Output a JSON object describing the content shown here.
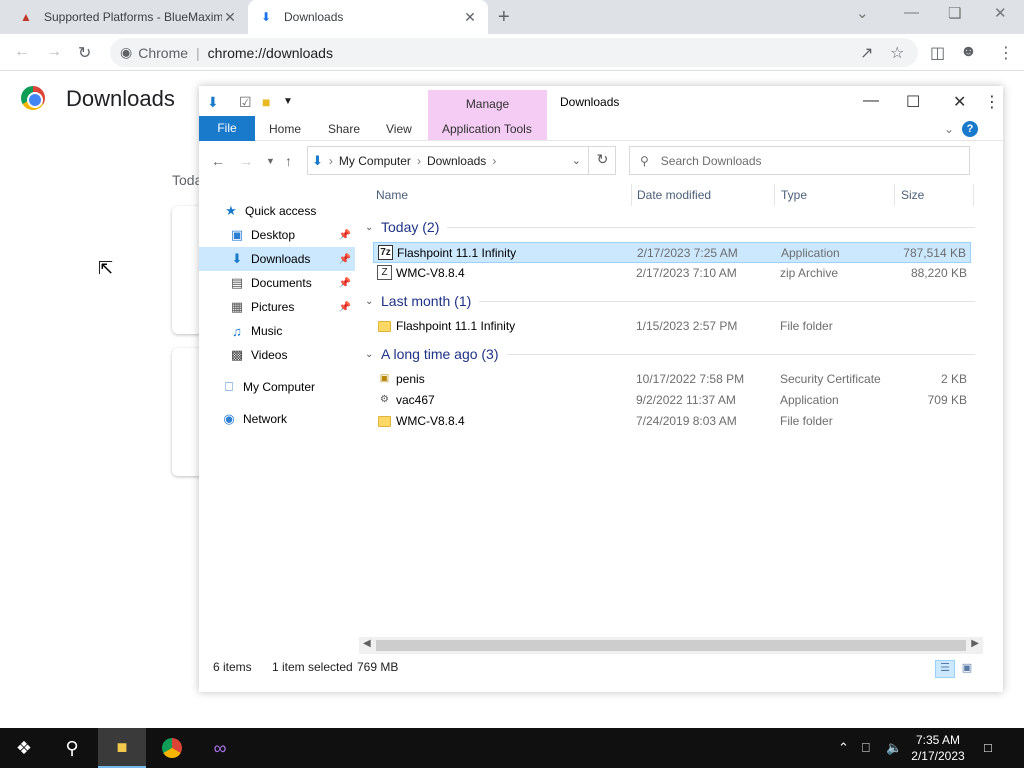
{
  "chrome": {
    "tabs": [
      {
        "title": "Supported Platforms - BlueMaxim",
        "icon": "flashpoint-favicon"
      },
      {
        "title": "Downloads",
        "icon": "download-icon"
      }
    ],
    "omnibox": {
      "site_label": "Chrome",
      "url": "chrome://downloads"
    },
    "page_title": "Downloads",
    "today_label": "Toda"
  },
  "explorer": {
    "title": "Downloads",
    "context_tab": "Manage",
    "ribbon_tabs": [
      "File",
      "Home",
      "Share",
      "View",
      "Application Tools"
    ],
    "address": [
      "My Computer",
      "Downloads"
    ],
    "search_placeholder": "Search Downloads",
    "nav": [
      {
        "label": "Quick access",
        "icon": "star-icon"
      },
      {
        "label": "Desktop",
        "icon": "desktop-icon",
        "pinned": true
      },
      {
        "label": "Downloads",
        "icon": "download-icon",
        "pinned": true,
        "selected": true
      },
      {
        "label": "Documents",
        "icon": "document-icon",
        "pinned": true
      },
      {
        "label": "Pictures",
        "icon": "picture-icon",
        "pinned": true
      },
      {
        "label": "Music",
        "icon": "music-icon"
      },
      {
        "label": "Videos",
        "icon": "video-icon"
      },
      {
        "label": "My Computer",
        "icon": "computer-icon"
      },
      {
        "label": "Network",
        "icon": "network-icon"
      }
    ],
    "columns": [
      "Name",
      "Date modified",
      "Type",
      "Size"
    ],
    "groups": [
      {
        "label": "Today (2)",
        "files": [
          {
            "name": "Flashpoint 11.1 Infinity",
            "date": "2/17/2023 7:25 AM",
            "type": "Application",
            "size": "787,514 KB",
            "icon": "7z-icon",
            "selected": true
          },
          {
            "name": "WMC-V8.8.4",
            "date": "2/17/2023 7:10 AM",
            "type": "zip Archive",
            "size": "88,220 KB",
            "icon": "zip-icon"
          }
        ]
      },
      {
        "label": "Last month (1)",
        "files": [
          {
            "name": "Flashpoint 11.1 Infinity",
            "date": "1/15/2023 2:57 PM",
            "type": "File folder",
            "size": "",
            "icon": "folder-icon"
          }
        ]
      },
      {
        "label": "A long time ago (3)",
        "files": [
          {
            "name": "penis",
            "date": "10/17/2022 7:58 PM",
            "type": "Security Certificate",
            "size": "2 KB",
            "icon": "certificate-icon"
          },
          {
            "name": "vac467",
            "date": "9/2/2022 11:37 AM",
            "type": "Application",
            "size": "709 KB",
            "icon": "app-icon"
          },
          {
            "name": "WMC-V8.8.4",
            "date": "7/24/2019 8:03 AM",
            "type": "File folder",
            "size": "",
            "icon": "folder-icon"
          }
        ]
      }
    ],
    "status": {
      "items": "6 items",
      "selected": "1 item selected",
      "size": "769 MB"
    }
  },
  "taskbar": {
    "time": "7:35 AM",
    "date": "2/17/2023"
  }
}
